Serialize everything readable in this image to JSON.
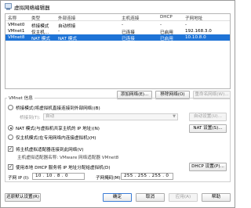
{
  "window": {
    "title": "虚拟网络编辑器"
  },
  "table": {
    "headers": [
      "名称",
      "类型",
      "外部连接",
      "主机连接",
      "DHCP",
      "子网地址"
    ],
    "rows": [
      [
        "VMnet0",
        "桥接模式",
        "自动桥接",
        "-",
        "-",
        "-"
      ],
      [
        "VMnet1",
        "仅主机...",
        "-",
        "已连接",
        "已启用",
        "192.168.3.0"
      ],
      [
        "VMnet8",
        "NAT 模式",
        "NAT 模式",
        "已连接",
        "已启用",
        "10.10.8.0"
      ]
    ],
    "selected_index": 2
  },
  "table_buttons": {
    "add_network": "添加网络(E)...",
    "remove_network": "移除网络(O)",
    "rename_network": "重命名网络(W)..."
  },
  "vmnet_info": {
    "title": "VMnet 信息",
    "bridged_label": "桥接模式(将虚拟机直接连接到外部网络)(B)",
    "bridged_to_label": "桥接到(T):",
    "bridged_to_value": "自动",
    "auto_settings": "自动设置(U)...",
    "nat_label": "NAT 模式(与虚拟机共享主机的 IP 地址)(N)",
    "nat_settings": "NAT 设置(S)...",
    "hostonly_label": "仅主机模式(在专用网络内连接虚拟机)(H)",
    "connect_adapter_label": "将主机虚拟适配器连接到此网络(V)",
    "adapter_name_label": "主机虚拟适配器名称: VMware 网络适配器 VMnet8",
    "dhcp_label": "使用本地 DHCP 服务将 IP 地址分配给虚拟机(D)",
    "dhcp_settings": "DHCP 设置(P)...",
    "subnet_ip_label": "子网 IP (I):",
    "subnet_ip_value": "10 . 10 . 8 . 0",
    "subnet_mask_label": "子网掩码(M):",
    "subnet_mask_value": "255 . 255 . 255 . 0"
  },
  "footer": {
    "restore_defaults": "还原默认设置(R)",
    "ok": "确定",
    "cancel": "取消",
    "apply": "应用(A)",
    "help": "帮助"
  },
  "colors": {
    "selection": "#1e73d6",
    "accent_border": "#3a7bd5"
  }
}
